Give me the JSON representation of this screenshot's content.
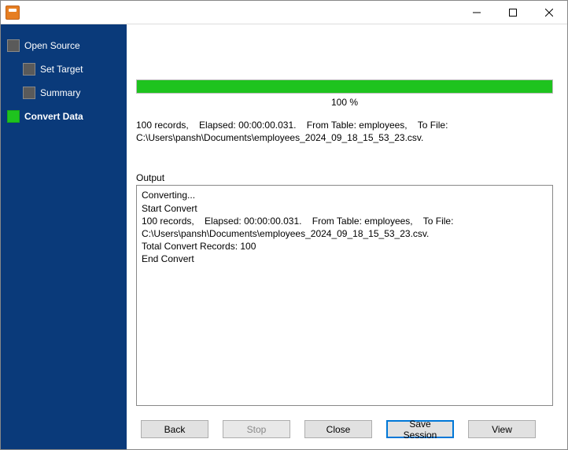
{
  "window": {
    "title": ""
  },
  "sidebar": {
    "items": [
      {
        "label": "Open Source",
        "active": false,
        "sub": false
      },
      {
        "label": "Set Target",
        "active": false,
        "sub": true
      },
      {
        "label": "Summary",
        "active": false,
        "sub": true
      },
      {
        "label": "Convert Data",
        "active": true,
        "sub": false
      }
    ]
  },
  "progress": {
    "percent": 100,
    "label": "100 %"
  },
  "status": "100 records,    Elapsed: 00:00:00.031.    From Table: employees,    To File: C:\\Users\\pansh\\Documents\\employees_2024_09_18_15_53_23.csv.",
  "output": {
    "label": "Output",
    "text": "Converting...\nStart Convert\n100 records,    Elapsed: 00:00:00.031.    From Table: employees,    To File: C:\\Users\\pansh\\Documents\\employees_2024_09_18_15_53_23.csv.\nTotal Convert Records: 100\nEnd Convert"
  },
  "buttons": {
    "back": "Back",
    "stop": "Stop",
    "close": "Close",
    "save_session": "Save Session",
    "view": "View"
  }
}
